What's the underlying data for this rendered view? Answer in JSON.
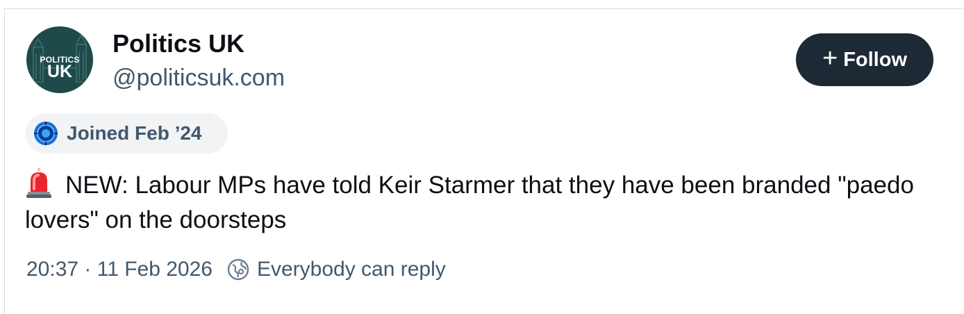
{
  "profile": {
    "display_name": "Politics UK",
    "handle": "@politicsuk.com",
    "avatar_line1": "POLITICS",
    "avatar_line2": "UK",
    "avatar_color": "#1f4a4a"
  },
  "follow_button": {
    "icon": "plus-icon",
    "label": "Follow",
    "background": "#1e2936"
  },
  "joined_badge": {
    "icon": "verified-badge-icon",
    "label": "Joined Feb ’24"
  },
  "post": {
    "icon": "siren-emoji",
    "text": "NEW: Labour MPs have told Keir Starmer that they have been branded \"paedo lovers\" on the doorsteps"
  },
  "meta": {
    "timestamp": "20:37 · 11 Feb 2026",
    "reply_icon": "globe-icon",
    "reply_setting": "Everybody can reply"
  }
}
